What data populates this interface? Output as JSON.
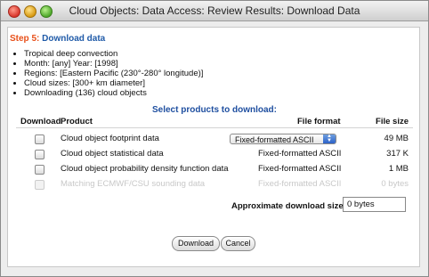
{
  "window": {
    "title": "Cloud Objects: Data Access: Review Results: Download Data"
  },
  "step": {
    "number": "Step 5:",
    "label": "Download data"
  },
  "summary": [
    "Tropical deep convection",
    "Month: [any]  Year: [1998]",
    "Regions: [Eastern Pacific (230°-280° longitude)]",
    "Cloud sizes: [300+ km diameter]",
    "Downloading (136) cloud objects"
  ],
  "select_heading": "Select products to download:",
  "table": {
    "col_download": "Download",
    "col_product": "Product",
    "col_format": "File format",
    "col_size": "File size",
    "rows": [
      {
        "product": "Cloud object footprint data",
        "format": "Fixed-formatted ASCII",
        "size": "49 MB",
        "has_popup": true,
        "disabled": false
      },
      {
        "product": "Cloud object statistical data",
        "format": "Fixed-formatted ASCII",
        "size": "317 K",
        "has_popup": false,
        "disabled": false
      },
      {
        "product": "Cloud object probability density function data",
        "format": "Fixed-formatted ASCII",
        "size": "1 MB",
        "has_popup": false,
        "disabled": false
      },
      {
        "product": "Matching ECMWF/CSU sounding data",
        "format": "Fixed-formatted ASCII",
        "size": "0 bytes",
        "has_popup": false,
        "disabled": true
      }
    ]
  },
  "estimate": {
    "label": "Approximate download size:",
    "value": "0 bytes"
  },
  "buttons": {
    "download": "Download",
    "cancel": "Cancel"
  }
}
